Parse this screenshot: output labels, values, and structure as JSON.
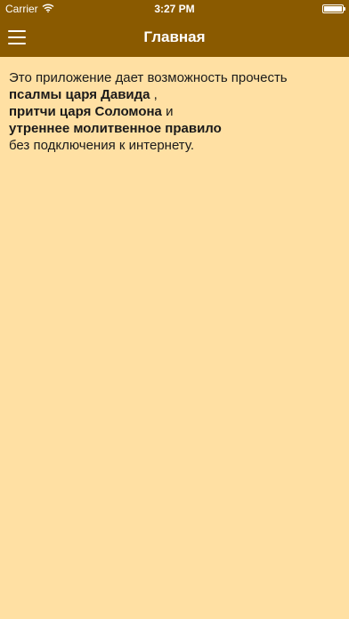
{
  "status_bar": {
    "carrier": "Carrier",
    "time": "3:27 PM",
    "wifi_icon": "wifi-icon",
    "battery_icon": "battery-icon"
  },
  "navbar": {
    "title": "Главная",
    "menu_icon": "hamburger-menu-icon"
  },
  "content": {
    "intro": "Это приложение дает возможность прочесть",
    "item1": "псалмы царя Давида",
    "item1_suffix": " ,",
    "item2": "притчи царя Соломона",
    "item2_suffix": " и",
    "item3": "утреннее молитвенное правило",
    "outro": "без подключения к интернету."
  },
  "colors": {
    "header_background": "#8A5A00",
    "page_background": "#FFE0A3",
    "header_text": "#FFFFFF",
    "body_text": "#1A1A1A"
  }
}
